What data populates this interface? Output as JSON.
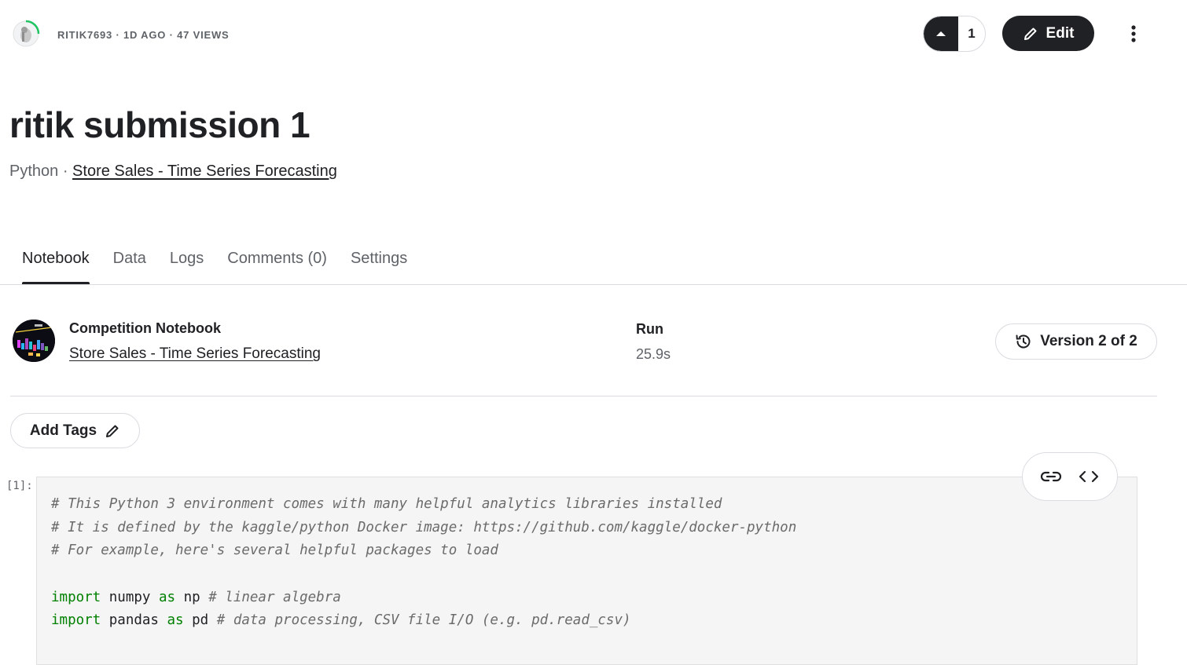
{
  "header": {
    "meta": "RITIK7693 · 1D AGO · 47 VIEWS",
    "vote_count": "1",
    "edit_label": "Edit"
  },
  "notebook": {
    "title": "ritik submission 1",
    "language": "Python",
    "separator": " · ",
    "competition_link": "Store Sales - Time Series Forecasting"
  },
  "tabs": [
    {
      "label": "Notebook",
      "active": true
    },
    {
      "label": "Data"
    },
    {
      "label": "Logs"
    },
    {
      "label": "Comments (0)"
    },
    {
      "label": "Settings"
    }
  ],
  "competition": {
    "label": "Competition Notebook",
    "name": "Store Sales - Time Series Forecasting"
  },
  "run": {
    "label": "Run",
    "duration": "25.9s"
  },
  "version": {
    "label": "Version 2 of 2"
  },
  "tags": {
    "add_label": "Add Tags"
  },
  "cell": {
    "prompt": "[1]:",
    "lines": [
      [
        {
          "t": "# This Python 3 environment comes with many helpful analytics libraries installed",
          "c": "cm"
        }
      ],
      [
        {
          "t": "# It is defined by the kaggle/python Docker image: https://github.com/kaggle/docker-python",
          "c": "cm"
        }
      ],
      [
        {
          "t": "# For example, here's several helpful packages to load",
          "c": "cm"
        }
      ],
      [],
      [
        {
          "t": "import",
          "c": "kw"
        },
        {
          "t": " numpy ",
          "c": ""
        },
        {
          "t": "as",
          "c": "kw"
        },
        {
          "t": " np ",
          "c": ""
        },
        {
          "t": "# linear algebra",
          "c": "cm"
        }
      ],
      [
        {
          "t": "import",
          "c": "kw"
        },
        {
          "t": " pandas ",
          "c": ""
        },
        {
          "t": "as",
          "c": "kw"
        },
        {
          "t": " pd ",
          "c": ""
        },
        {
          "t": "# data processing, CSV file I/O (e.g. pd.read_csv)",
          "c": "cm"
        }
      ]
    ]
  },
  "colors": {
    "primary": "#202124",
    "muted": "#5f6368",
    "progress_ring": "#20BEFF",
    "keyword": "#008000",
    "comment": "#6b6b6b",
    "code_bg": "#f5f5f5"
  },
  "icons": [
    "avatar-progress-ring",
    "caret-up-icon",
    "pencil-icon",
    "more-vert-icon",
    "history-icon",
    "link-icon",
    "code-icon"
  ]
}
